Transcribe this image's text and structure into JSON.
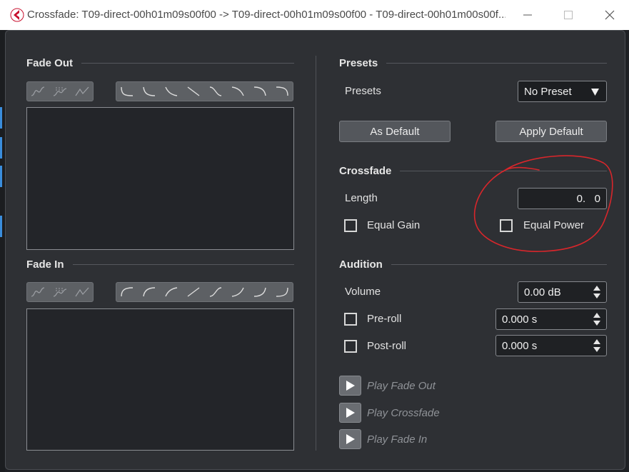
{
  "window": {
    "title": "Crossfade: T09-direct-00h01m09s00f00 -> T09-direct-00h01m09s00f00 - T09-direct-00h01m00s00f...",
    "logo_color": "#c8102e",
    "controls": [
      "minimize-icon",
      "maximize-icon",
      "close-icon"
    ]
  },
  "fade_out": {
    "title": "Fade Out",
    "shape_icons": [
      "spline-icon",
      "damped-spline-icon",
      "linear-icon"
    ],
    "curve_icons": [
      "curve-1-icon",
      "curve-2-icon",
      "curve-3-icon",
      "curve-4-icon",
      "curve-5-icon",
      "curve-6-icon",
      "curve-7-icon",
      "curve-8-icon"
    ]
  },
  "fade_in": {
    "title": "Fade In",
    "shape_icons": [
      "spline-icon",
      "damped-spline-icon",
      "linear-icon"
    ],
    "curve_icons": [
      "curve-1-icon",
      "curve-2-icon",
      "curve-3-icon",
      "curve-4-icon",
      "curve-5-icon",
      "curve-6-icon",
      "curve-7-icon",
      "curve-8-icon"
    ]
  },
  "presets": {
    "title": "Presets",
    "label": "Presets",
    "selected": "No Preset",
    "as_default": "As Default",
    "apply_default": "Apply Default"
  },
  "crossfade": {
    "title": "Crossfade",
    "length_label": "Length",
    "length_value": "0.   0",
    "equal_gain": "Equal Gain",
    "equal_power": "Equal Power",
    "equal_gain_checked": false,
    "equal_power_checked": false
  },
  "audition": {
    "title": "Audition",
    "volume_label": "Volume",
    "volume_value": "0.00 dB",
    "preroll_label": "Pre-roll",
    "preroll_value": "0.000 s",
    "postroll_label": "Post-roll",
    "postroll_value": "0.000 s",
    "play_fade_out": "Play Fade Out",
    "play_crossfade": "Play Crossfade",
    "play_fade_in": "Play Fade In"
  },
  "annotation_color": "#d8262b"
}
